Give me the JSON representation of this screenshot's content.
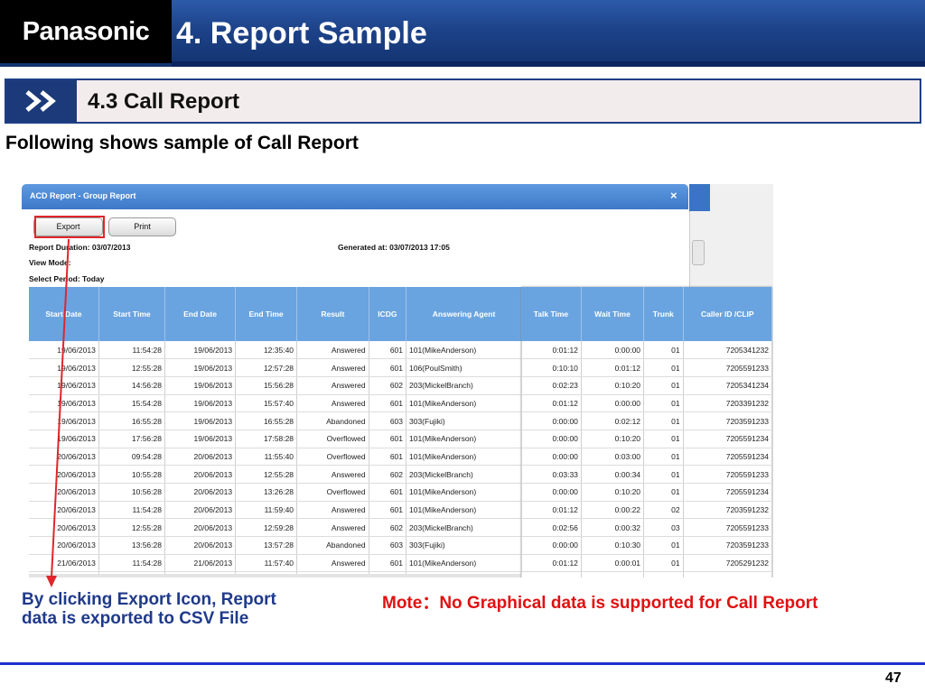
{
  "header": {
    "logo": "Panasonic",
    "title": "4. Report Sample"
  },
  "section": {
    "title": "4.3 Call Report"
  },
  "intro": "Following shows sample of Call Report",
  "dialog": {
    "title": "ACD Report - Group Report",
    "close": "×",
    "export_label": "Export",
    "print_label": "Print",
    "duration": "Report Duration: 03/07/2013",
    "generated": "Generated at: 03/07/2013 17:05",
    "view_mode": "View Mode:",
    "select_period": "Select Period: Today"
  },
  "left_table": {
    "headers": [
      "Start Date",
      "Start Time",
      "End Date",
      "End Time",
      "Result",
      "ICDG",
      "Answering Agent"
    ],
    "rows": [
      [
        "19/06/2013",
        "11:54:28",
        "19/06/2013",
        "12:35:40",
        "Answered",
        "601",
        "101(MikeAnderson)"
      ],
      [
        "19/06/2013",
        "12:55:28",
        "19/06/2013",
        "12:57:28",
        "Answered",
        "601",
        "106(PoulSmith)"
      ],
      [
        "19/06/2013",
        "14:56:28",
        "19/06/2013",
        "15:56:28",
        "Answered",
        "602",
        "203(MickelBranch)"
      ],
      [
        "19/06/2013",
        "15:54:28",
        "19/06/2013",
        "15:57:40",
        "Answered",
        "601",
        "101(MikeAnderson)"
      ],
      [
        "19/06/2013",
        "16:55:28",
        "19/06/2013",
        "16:55:28",
        "Abandoned",
        "603",
        "303(Fujiki)"
      ],
      [
        "19/06/2013",
        "17:56:28",
        "19/06/2013",
        "17:58:28",
        "Overflowed",
        "601",
        "101(MikeAnderson)"
      ],
      [
        "20/06/2013",
        "09:54:28",
        "20/06/2013",
        "11:55:40",
        "Overflowed",
        "601",
        "101(MikeAnderson)"
      ],
      [
        "20/06/2013",
        "10:55:28",
        "20/06/2013",
        "12:55:28",
        "Answered",
        "602",
        "203(MickelBranch)"
      ],
      [
        "20/06/2013",
        "10:56:28",
        "20/06/2013",
        "13:26:28",
        "Overflowed",
        "601",
        "101(MikeAnderson)"
      ],
      [
        "20/06/2013",
        "11:54:28",
        "20/06/2013",
        "11:59:40",
        "Answered",
        "601",
        "101(MikeAnderson)"
      ],
      [
        "20/06/2013",
        "12:55:28",
        "20/06/2013",
        "12:59:28",
        "Answered",
        "602",
        "203(MickelBranch)"
      ],
      [
        "20/06/2013",
        "13:56:28",
        "20/06/2013",
        "13:57:28",
        "Abandoned",
        "603",
        "303(Fujiki)"
      ],
      [
        "21/06/2013",
        "11:54:28",
        "21/06/2013",
        "11:57:40",
        "Answered",
        "601",
        "101(MikeAnderson)"
      ]
    ]
  },
  "right_table": {
    "headers": [
      "Talk Time",
      "Wait Time",
      "Trunk",
      "Caller ID /CLIP"
    ],
    "rows": [
      [
        "0:01:12",
        "0:00:00",
        "01",
        "7205341232"
      ],
      [
        "0:10:10",
        "0:01:12",
        "01",
        "7205591233"
      ],
      [
        "0:02:23",
        "0:10:20",
        "01",
        "7205341234"
      ],
      [
        "0:01:12",
        "0:00:00",
        "01",
        "7203391232"
      ],
      [
        "0:00:00",
        "0:02:12",
        "01",
        "7203591233"
      ],
      [
        "0:00:00",
        "0:10:20",
        "01",
        "7205591234"
      ],
      [
        "0:00:00",
        "0:03:00",
        "01",
        "7205591234"
      ],
      [
        "0:03:33",
        "0:00:34",
        "01",
        "7205591233"
      ],
      [
        "0:00:00",
        "0:10:20",
        "01",
        "7205591234"
      ],
      [
        "0:01:12",
        "0:00:22",
        "02",
        "7203591232"
      ],
      [
        "0:02:56",
        "0:00:32",
        "03",
        "7205591233"
      ],
      [
        "0:00:00",
        "0:10:30",
        "01",
        "7203591233"
      ],
      [
        "0:01:12",
        "0:00:01",
        "01",
        "7205291232"
      ]
    ]
  },
  "note_left": "By clicking Export  Icon, Report data is exported to CSV File",
  "note_right": "Mote：No Graphical data is supported for Call Report",
  "page_number": "47",
  "colors": {
    "header": "#1d4289",
    "accent_red": "#e01111",
    "note_blue": "#1f3a8a",
    "table_header": "#6aa4e0"
  }
}
